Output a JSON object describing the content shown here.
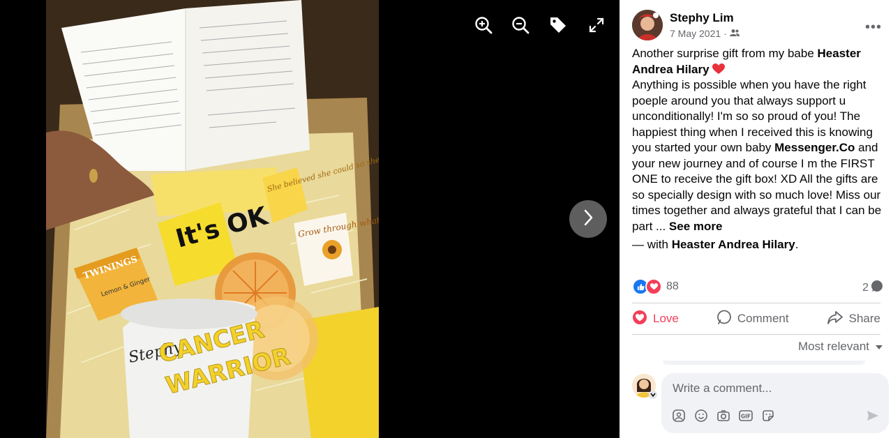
{
  "viewer": {
    "tools": {
      "zoom_in_icon": "zoom-in-icon",
      "zoom_out_icon": "zoom-out-icon",
      "tag_icon": "tag-icon",
      "fullscreen_icon": "fullscreen-icon",
      "next_icon": "chevron-right-icon"
    },
    "photo_text": {
      "tea_brand": "TWININGS",
      "tea_flavor": "Lemon & Ginger",
      "mug_name": "Stephy",
      "mug_line1": "CANCER",
      "mug_line2": "WARRIOR",
      "socks_text": "It's OK",
      "tag1_text": "She believed she could so she did",
      "tag2_text": "Grow through what you go through"
    }
  },
  "post": {
    "author": "Stephy Lim",
    "date": "7 May 2021",
    "audience_icon": "friends-icon",
    "text_intro": "Another surprise gift from my babe ",
    "tag_name": "Heaster Andrea Hilary",
    "heart_emoji": "❤️",
    "text_part2": "Anything is possible when you have the right poeple around you that always support u unconditionally! I'm so so proud of you! The happiest thing when I received this is knowing you started your own baby ",
    "brand": "Messenger.Co",
    "text_part3": " and your new journey and of course I m the FIRST ONE to receive the gift box! XD All the gifts are so specially design with so much love! Miss our times together and always grateful that I can be part ... ",
    "see_more": "See more",
    "with_prefix": "— with ",
    "with_name": "Heaster Andrea Hilary",
    "with_suffix": "."
  },
  "reactions": {
    "count": "88",
    "comments_count": "2"
  },
  "actions": {
    "love": "Love",
    "comment": "Comment",
    "share": "Share"
  },
  "comments": {
    "sort_label": "Most relevant",
    "placeholder": "Write a comment..."
  },
  "colors": {
    "love": "#f33e58",
    "like": "#1877f2",
    "muted": "#65676b"
  }
}
